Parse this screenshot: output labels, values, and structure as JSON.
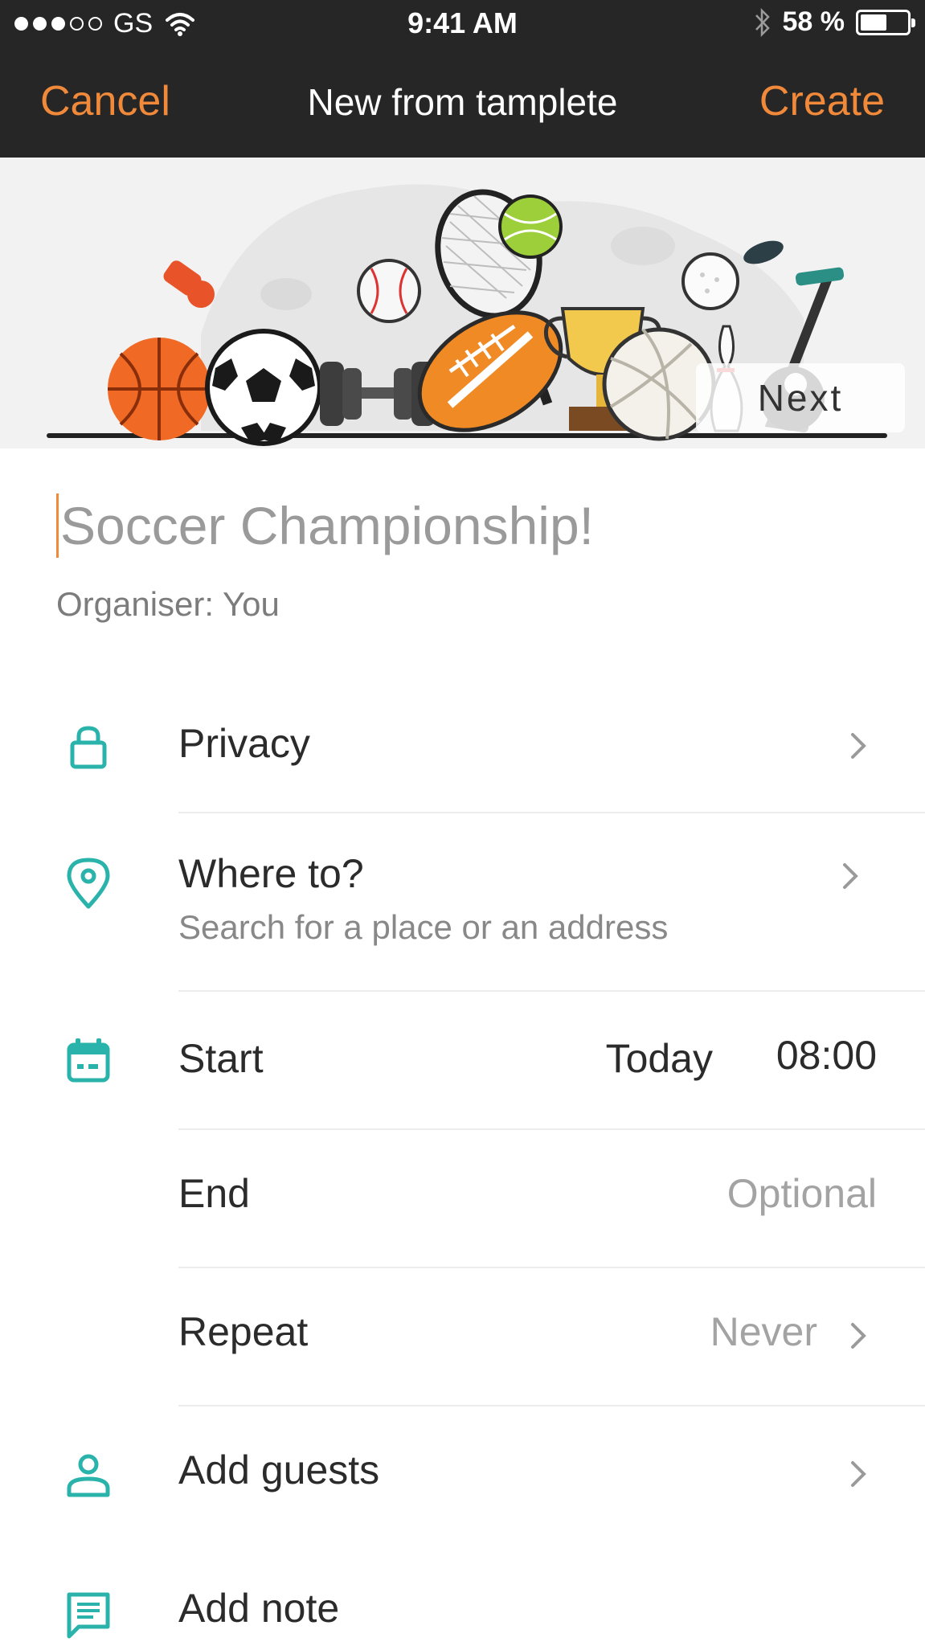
{
  "status_bar": {
    "carrier": "GS",
    "time": "9:41 AM",
    "battery": "58 %",
    "battery_level": 0.58
  },
  "nav": {
    "cancel": "Cancel",
    "title": "New from tamplete",
    "create": "Create"
  },
  "banner": {
    "next": "Next"
  },
  "event": {
    "title_placeholder": "Soccer Championship!",
    "organiser": "Organiser: You"
  },
  "rows": {
    "privacy": {
      "label": "Privacy"
    },
    "location": {
      "label": "Where to?",
      "placeholder": "Search for a place or an address"
    },
    "start": {
      "label": "Start",
      "date": "Today",
      "time": "08:00"
    },
    "end": {
      "label": "End",
      "value": "Optional"
    },
    "repeat": {
      "label": "Repeat",
      "value": "Never"
    },
    "guests": {
      "label": "Add guests"
    },
    "note": {
      "label": "Add note"
    }
  },
  "colors": {
    "accent_orange": "#f0893a",
    "icon_teal": "#2ab3ab",
    "nav_bg": "#262626",
    "muted_text": "#a3a3a3"
  }
}
